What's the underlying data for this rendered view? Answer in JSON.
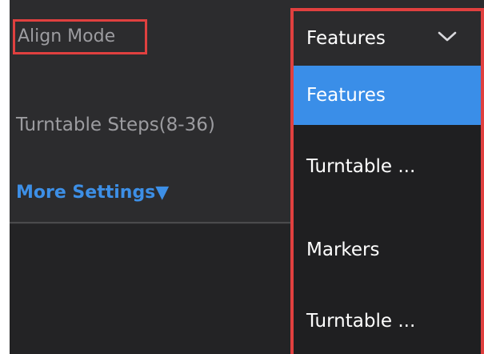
{
  "settings": {
    "align_mode_label": "Align Mode",
    "turntable_steps_label": "Turntable Steps(8-36)",
    "more_settings_label": "More Settings▼"
  },
  "dropdown": {
    "selected_value": "Features",
    "chevron_icon": "chevron-down-icon",
    "options": [
      {
        "label": "Features",
        "selected": true
      },
      {
        "label": "Turntable ...",
        "selected": false
      },
      {
        "label": "Markers",
        "selected": false
      },
      {
        "label": "Turntable ...",
        "selected": false
      }
    ]
  },
  "colors": {
    "highlight_border": "#e0403f",
    "accent": "#3a8ee8",
    "link": "#3d8fe6"
  }
}
